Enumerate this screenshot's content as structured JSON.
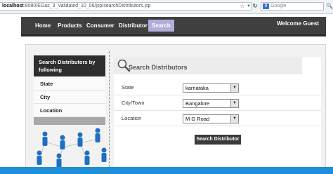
{
  "browser": {
    "url_host": "localhost",
    "url_path": ":8080/EGas_3_Validated_10_06/jsp/searchDistributors.jsp",
    "search_engine": "Google",
    "search_placeholder": "Google"
  },
  "nav": {
    "items": [
      "Home",
      "Products",
      "Consumer",
      "Distributor",
      "Search"
    ],
    "active": "Search",
    "welcome": "Welcome Guest"
  },
  "sidebar": {
    "title": "Search Distributors by following",
    "items": [
      "State",
      "City",
      "Location"
    ]
  },
  "form": {
    "heading": "Search Distributors",
    "fields": [
      {
        "label": "State",
        "value": "karnataka"
      },
      {
        "label": "City/Town",
        "value": "Bangalore"
      },
      {
        "label": "Location",
        "value": "M G Road"
      }
    ],
    "submit_label": "Search Distributor"
  },
  "colors": {
    "nav_bg": "#3f3f3f",
    "active_tab": "#b0aed9",
    "sidebar_title_bg": "#2e2e2e",
    "button_bg": "#3a3a3a",
    "taskbar": "#1e8fd6",
    "people_figures": "#1f6fc1"
  },
  "icons": {
    "head": "magnifier-icon",
    "people": "people-network-illustration"
  }
}
